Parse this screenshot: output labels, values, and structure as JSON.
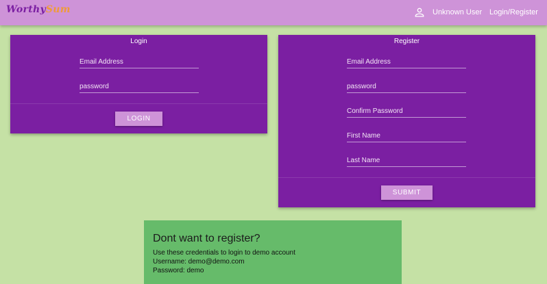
{
  "header": {
    "logo_main": "Worthy",
    "logo_accent": "Sum",
    "user_label": "Unknown User",
    "auth_link": "Login/Register",
    "user_icon": "account-icon"
  },
  "login": {
    "title": "Login",
    "email_placeholder": "Email Address",
    "password_placeholder": "password",
    "button_label": "LOGIN"
  },
  "register": {
    "title": "Register",
    "email_placeholder": "Email Address",
    "password_placeholder": "password",
    "confirm_placeholder": "Confirm Password",
    "first_name_placeholder": "First Name",
    "last_name_placeholder": "Last Name",
    "button_label": "SUBMIT"
  },
  "demo": {
    "title": "Dont want to register?",
    "line1": "Use these credentials to login to demo account",
    "line2": "Username: demo@demo.com",
    "line3": "Password: demo"
  },
  "colors": {
    "background": "#c5e1a5",
    "topbar": "#ce93d8",
    "card": "#7b1fa2",
    "button": "#ce93d8",
    "demo_box": "#66bb6a"
  }
}
